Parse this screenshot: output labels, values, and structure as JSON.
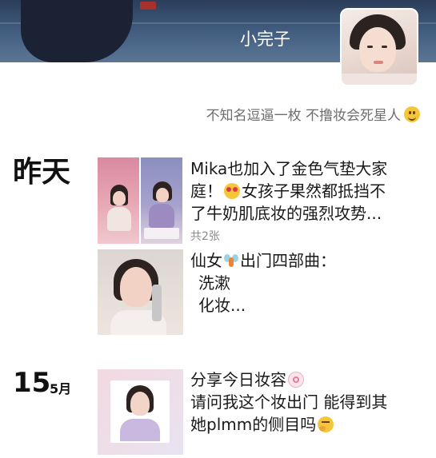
{
  "profile": {
    "nickname": "小完子",
    "signature": "不知名逗逼一枚 不撸妆会死星人",
    "signature_emoji": "smile-emoji"
  },
  "timeline": {
    "group1": {
      "date_label": "昨天",
      "posts": [
        {
          "lines": [
            "Mika也加入了金色气垫大家",
            "庭！",
            "女孩子果然都抵挡不",
            "了牛奶肌底妆的强烈攻势..."
          ],
          "inline_emoji": "heart-eyes-emoji",
          "image_count": "共2张"
        },
        {
          "title": "仙女",
          "title_suffix": "出门四部曲：",
          "inline_emoji": "fairy-emoji",
          "lines": [
            "洗漱",
            "化妆..."
          ]
        }
      ]
    },
    "group2": {
      "day": "15",
      "month": "5月",
      "posts": [
        {
          "line1": "分享今日妆容",
          "line1_emoji": "lollipop-emoji",
          "line2": "请问我这个妆出门 能得到其",
          "line3": "她plmm的侧目吗",
          "line3_emoji": "thinking-emoji"
        }
      ]
    }
  },
  "colors": {
    "cover_top": "#2b3e5a",
    "text_primary": "#1a1a1a",
    "text_secondary": "#6e6e6e",
    "count_text": "#8a8a8a"
  }
}
